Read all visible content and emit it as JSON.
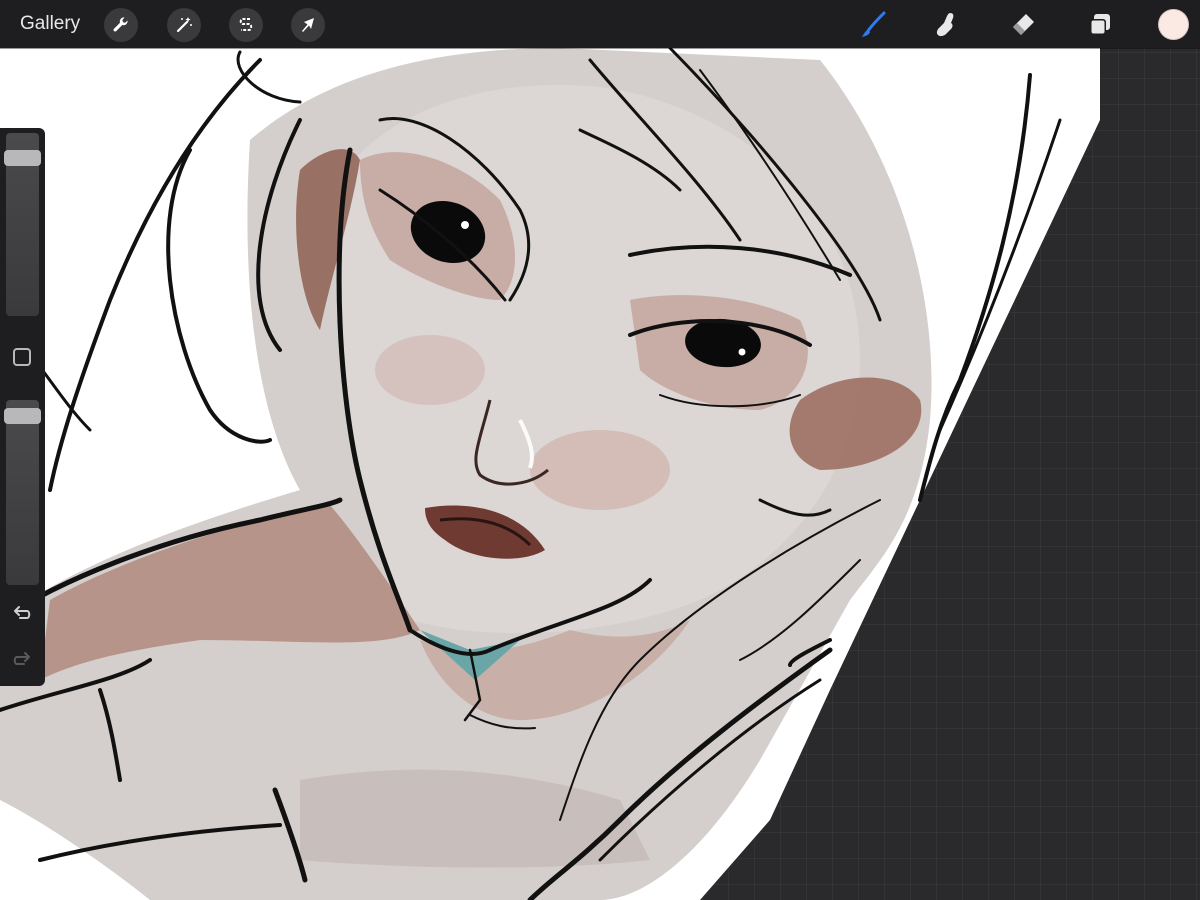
{
  "topbar": {
    "gallery_label": "Gallery",
    "left_tools": [
      {
        "name": "actions",
        "icon": "wrench-icon"
      },
      {
        "name": "adjustments",
        "icon": "magic-wand-icon"
      },
      {
        "name": "selection",
        "icon": "selection-s-icon"
      },
      {
        "name": "transform",
        "icon": "arrow-cursor-icon"
      }
    ],
    "right_tools": [
      {
        "name": "brush",
        "icon": "brush-icon",
        "active": true
      },
      {
        "name": "smudge",
        "icon": "smudge-finger-icon",
        "active": false
      },
      {
        "name": "eraser",
        "icon": "eraser-icon",
        "active": false
      },
      {
        "name": "layers",
        "icon": "layers-icon",
        "active": false
      }
    ],
    "current_color": "#fbe9e4"
  },
  "sidebar": {
    "brush_size_level": 0.9,
    "opacity_level": 0.95,
    "modify_icon": "square-icon",
    "undo_icon": "undo-arrow-icon",
    "redo_icon": "redo-arrow-icon"
  },
  "colors": {
    "app_bg": "#2a2a2c",
    "toolbar_bg": "#1e1e20",
    "active_tool": "#2d7cf6",
    "skin_base": "#d2ccca",
    "skin_shadow": "#8c5c4c",
    "lip": "#6e3a32",
    "collar_accent": "#6aa6a8",
    "ink": "#111111"
  }
}
